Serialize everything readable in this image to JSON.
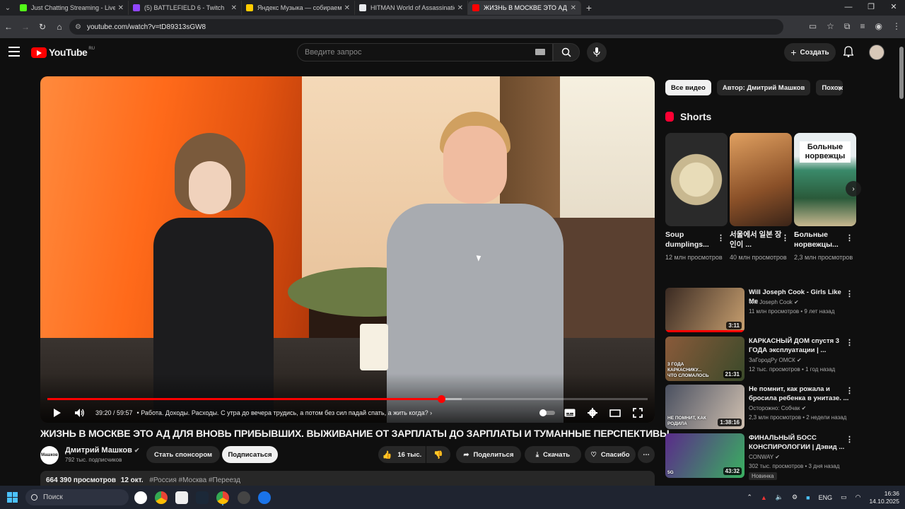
{
  "browser": {
    "tabs": [
      {
        "title": "Just Chatting Streaming - Live",
        "color": "#53fc18",
        "active": false
      },
      {
        "title": "(5) BATTLEFIELD 6 - Twitch",
        "color": "#9146ff",
        "active": false
      },
      {
        "title": "Яндекс Музыка — собираем",
        "color": "#ffcc00",
        "active": false
      },
      {
        "title": "HITMAN World of Assassinatio",
        "color": "#e8eaed",
        "active": false
      },
      {
        "title": "ЖИЗНЬ В МОСКВЕ ЭТО АД Д",
        "color": "#ff0000",
        "active": true
      }
    ],
    "url": "youtube.com/watch?v=tD89313sGW8"
  },
  "masthead": {
    "logo_text": "YouTube",
    "region": "RU",
    "search_placeholder": "Введите запрос",
    "create_label": "Создать"
  },
  "player": {
    "time": "39:20 / 59:57",
    "chapter": "• Работа. Доходы. Расходы. С утра до вечера трудись, а потом без сил падай спать, а жить когда?",
    "progress": 0.656,
    "buffered": 0.69
  },
  "video": {
    "title": "ЖИЗНЬ В МОСКВЕ ЭТО АД ДЛЯ ВНОВЬ ПРИБЫВШИХ. ВЫЖИВАНИЕ ОТ ЗАРПЛАТЫ ДО ЗАРПЛАТЫ И ТУМАННЫЕ ПЕРСПЕКТИВЫ.",
    "channel_avatar_text": "Машков",
    "channel_name": "Дмитрий Машков",
    "subscribers": "792 тыс. подписчиков",
    "sponsor_label": "Стать спонсором",
    "subscribe_label": "Подписаться",
    "likes": "16 тыс.",
    "share_label": "Поделиться",
    "download_label": "Скачать",
    "thanks_label": "Спасибо",
    "views": "664 390 просмотров",
    "date": "12 окт.",
    "tags": "#Россия #Москва #Переезд"
  },
  "sidebar": {
    "chips": [
      "Все видео",
      "Автор: Дмитрий Машков",
      "Похож"
    ],
    "shorts_title": "Shorts",
    "shorts": [
      {
        "title": "Soup dumplings...",
        "views": "12 млн просмотров",
        "overlay": ""
      },
      {
        "title": "서울에서 일본 장인이 ...",
        "views": "40 млн просмотров",
        "overlay": ""
      },
      {
        "title": "Больные норвежцы...",
        "views": "2,3 млн просмотров",
        "overlay": "Больные норвежцы"
      }
    ],
    "recommendations": [
      {
        "title": "Will Joseph Cook - Girls Like Me",
        "channel": "Will Joseph Cook",
        "meta": "11 млн просмотров • 9 лет назад",
        "duration": "3:11",
        "thumb_colors": [
          "#3a2a22",
          "#c8a070"
        ],
        "watched": 1.0,
        "badge": ""
      },
      {
        "title": "КАРКАСНЫЙ ДОМ спустя 3 ГОДА эксплуатации | ...",
        "channel": "ЗаГородРу ОМСК",
        "meta": "12 тыс. просмотров • 1 год назад",
        "duration": "21:31",
        "thumb_colors": [
          "#8a5a3a",
          "#3a4a2a"
        ],
        "watched": 0,
        "badge": "",
        "thumb_text": "3 ГОДА КАРКАСНИКУ... ЧТО СЛОМАЛОСЬ"
      },
      {
        "title": "Не помнит, как рожала и бросила ребенка в унитазе. ...",
        "channel": "Осторожно: Собчак",
        "meta": "2,3 млн просмотров • 2 недели назад",
        "duration": "1:38:16",
        "thumb_colors": [
          "#4a5060",
          "#d0c0b0"
        ],
        "watched": 0,
        "badge": "",
        "thumb_text": "НЕ ПОМНИТ, КАК РОДИЛА"
      },
      {
        "title": "ФИНАЛЬНЫЙ БОСС КОНСПИРОЛОГИИ | Дэвид ...",
        "channel": "CONWAY",
        "meta": "302 тыс. просмотров • 3 дня назад",
        "duration": "43:32",
        "thumb_colors": [
          "#5a2a8a",
          "#3ab060"
        ],
        "watched": 0,
        "badge": "Новинка",
        "thumb_text": "5G"
      }
    ]
  },
  "taskbar": {
    "search_placeholder": "Поиск",
    "lang": "ENG",
    "time": "16:36",
    "date": "14.10.2025"
  }
}
